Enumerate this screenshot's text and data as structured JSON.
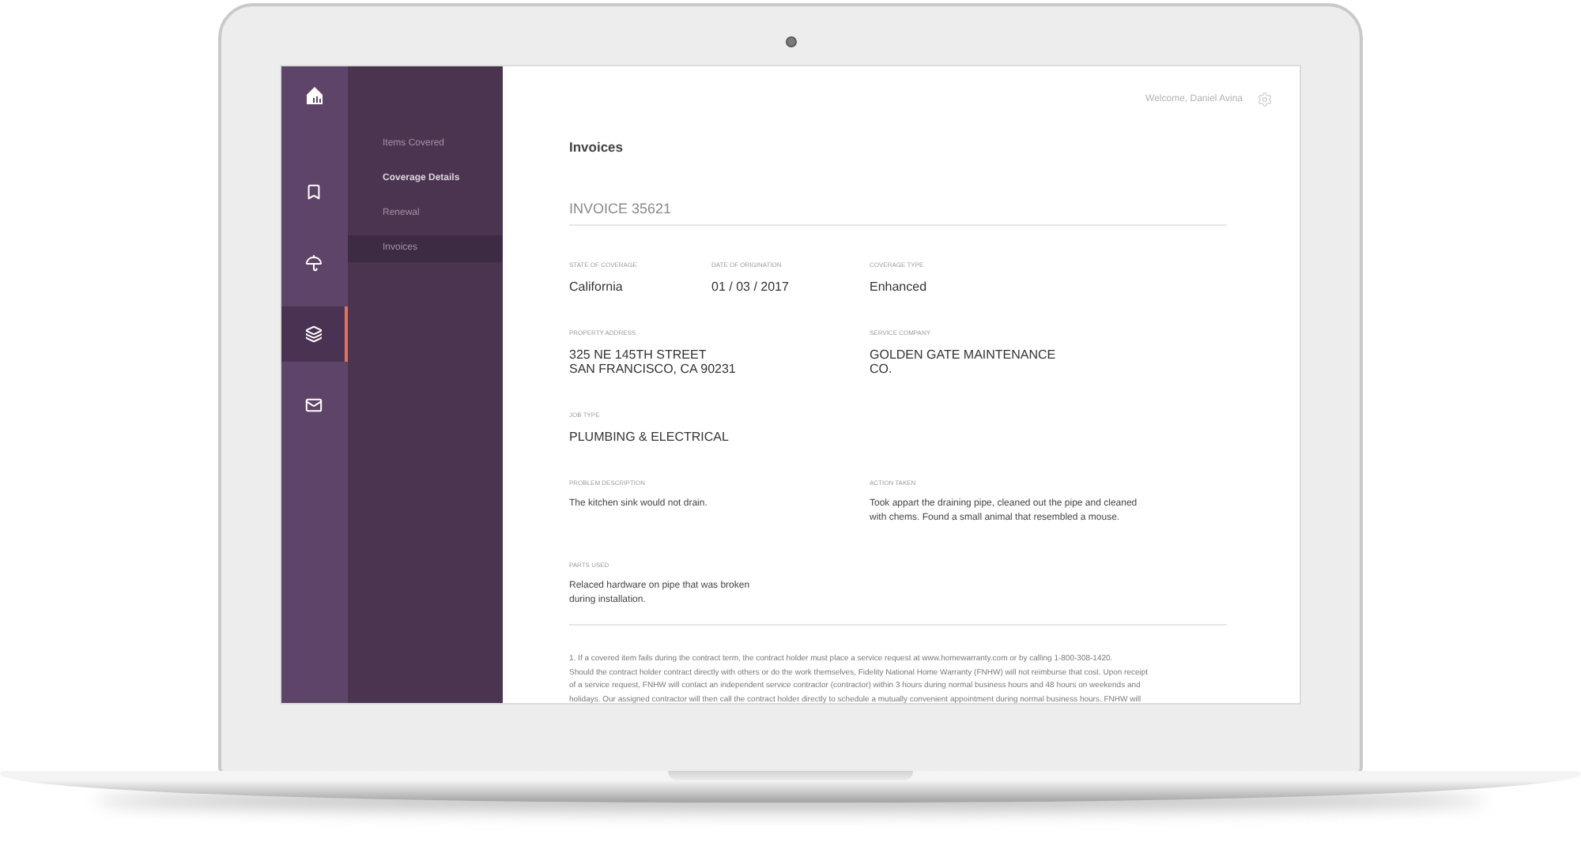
{
  "header": {
    "welcome": "Welcome, Daniel Avina"
  },
  "rail": [
    {
      "selected": false
    },
    {
      "selected": false
    },
    {
      "selected": true
    },
    {
      "selected": false
    }
  ],
  "subnav": [
    {
      "label": "Items Covered",
      "selected": false,
      "highlighted": false
    },
    {
      "label": "Coverage Details",
      "selected": false,
      "highlighted": true
    },
    {
      "label": "Renewal",
      "selected": false,
      "highlighted": false
    },
    {
      "label": "Invoices",
      "selected": true,
      "highlighted": false
    }
  ],
  "page_title": "Invoices",
  "invoice": {
    "number": "INVOICE 35621",
    "rows": [
      {
        "fields": [
          {
            "label": "STATE OF COVERAGE",
            "value": "California",
            "kind": "value"
          },
          {
            "label": "DATE OF ORIGINATION",
            "value": "01 / 03 / 2017",
            "kind": "value"
          },
          {
            "label": "COVERAGE TYPE",
            "value": "Enhanced",
            "kind": "value"
          }
        ]
      },
      {
        "fields": [
          {
            "label": "PROPERTY ADDRESS",
            "value": "325 NE 145TH STREET\nSAN FRANCISCO, CA 90231",
            "kind": "value"
          },
          {
            "label": "SERVICE COMPANY",
            "value": "GOLDEN GATE MAINTENANCE\nCO.",
            "kind": "value"
          }
        ]
      },
      {
        "fields": [
          {
            "label": "JOB TYPE",
            "value": "PLUMBING & ELECTRICAL",
            "kind": "value"
          }
        ]
      },
      {
        "fields": [
          {
            "label": "PROBLEM DESCRIPTION",
            "value": "The kitchen sink would not drain.",
            "kind": "text"
          },
          {
            "label": "ACTION TAKEN",
            "value": "Took appart the draining pipe, cleaned out the pipe and cleaned\nwith chems. Found a small animal that resembled a mouse.",
            "kind": "text"
          }
        ]
      },
      {
        "fields": [
          {
            "label": "PARTS USED",
            "value": "Relaced hardware on pipe that was broken\nduring installation.",
            "kind": "text"
          }
        ]
      }
    ]
  },
  "footnote": [
    "1. If a covered item fails during the contract term, the contract holder must place a service request at www.homewarranty.com or by calling 1-800-308-1420.",
    "Should the contract holder contract directly with others or do the work themselves, Fidelity National Home Warranty (FNHW) will not reimburse that cost. Upon receipt",
    "of a service request, FNHW will contact an independent service contractor (contractor) within 3 hours during normal business hours and 48 hours on weekends and",
    "holidays. Our assigned contractor will then call the contract holder directly to schedule a mutually convenient appointment during normal business hours. FNHW will"
  ]
}
